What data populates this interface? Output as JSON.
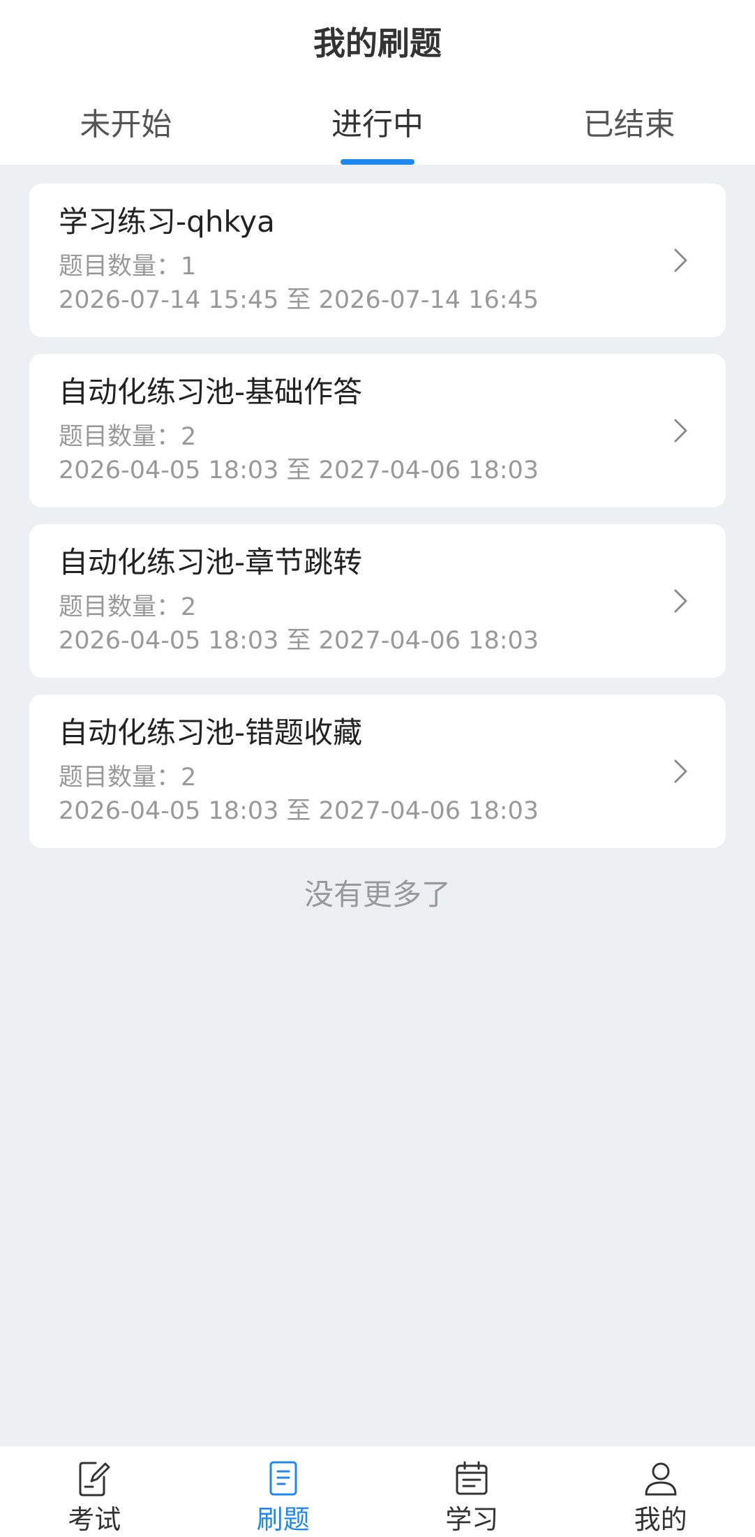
{
  "header": {
    "title": "我的刷题",
    "tabs": [
      {
        "label": "未开始"
      },
      {
        "label": "进行中"
      },
      {
        "label": "已结束"
      }
    ],
    "active_tab": "进行中"
  },
  "list": {
    "items": [
      {
        "title": "学习练习-qhkya",
        "count_label": "题目数量：1",
        "range": "2026-07-14 15:45 至 2026-07-14 16:45"
      },
      {
        "title": "自动化练习池-基础作答",
        "count_label": "题目数量：2",
        "range": "2026-04-05 18:03 至 2027-04-06 18:03"
      },
      {
        "title": "自动化练习池-章节跳转",
        "count_label": "题目数量：2",
        "range": "2026-04-05 18:03 至 2027-04-06 18:03"
      },
      {
        "title": "自动化练习池-错题收藏",
        "count_label": "题目数量：2",
        "range": "2026-04-05 18:03 至 2027-04-06 18:03"
      }
    ],
    "end_text": "没有更多了"
  },
  "tabbar": {
    "items": [
      {
        "label": "考试",
        "icon": "exam-edit-icon"
      },
      {
        "label": "刷题",
        "icon": "practice-document-icon"
      },
      {
        "label": "学习",
        "icon": "study-calendar-icon"
      },
      {
        "label": "我的",
        "icon": "profile-user-icon"
      }
    ],
    "active": "刷题"
  },
  "colors": {
    "accent": "#1e88ef",
    "page_background": "#edf0f3",
    "card_background": "#ffffff",
    "primary_text": "#222222",
    "secondary_text": "#999999"
  }
}
